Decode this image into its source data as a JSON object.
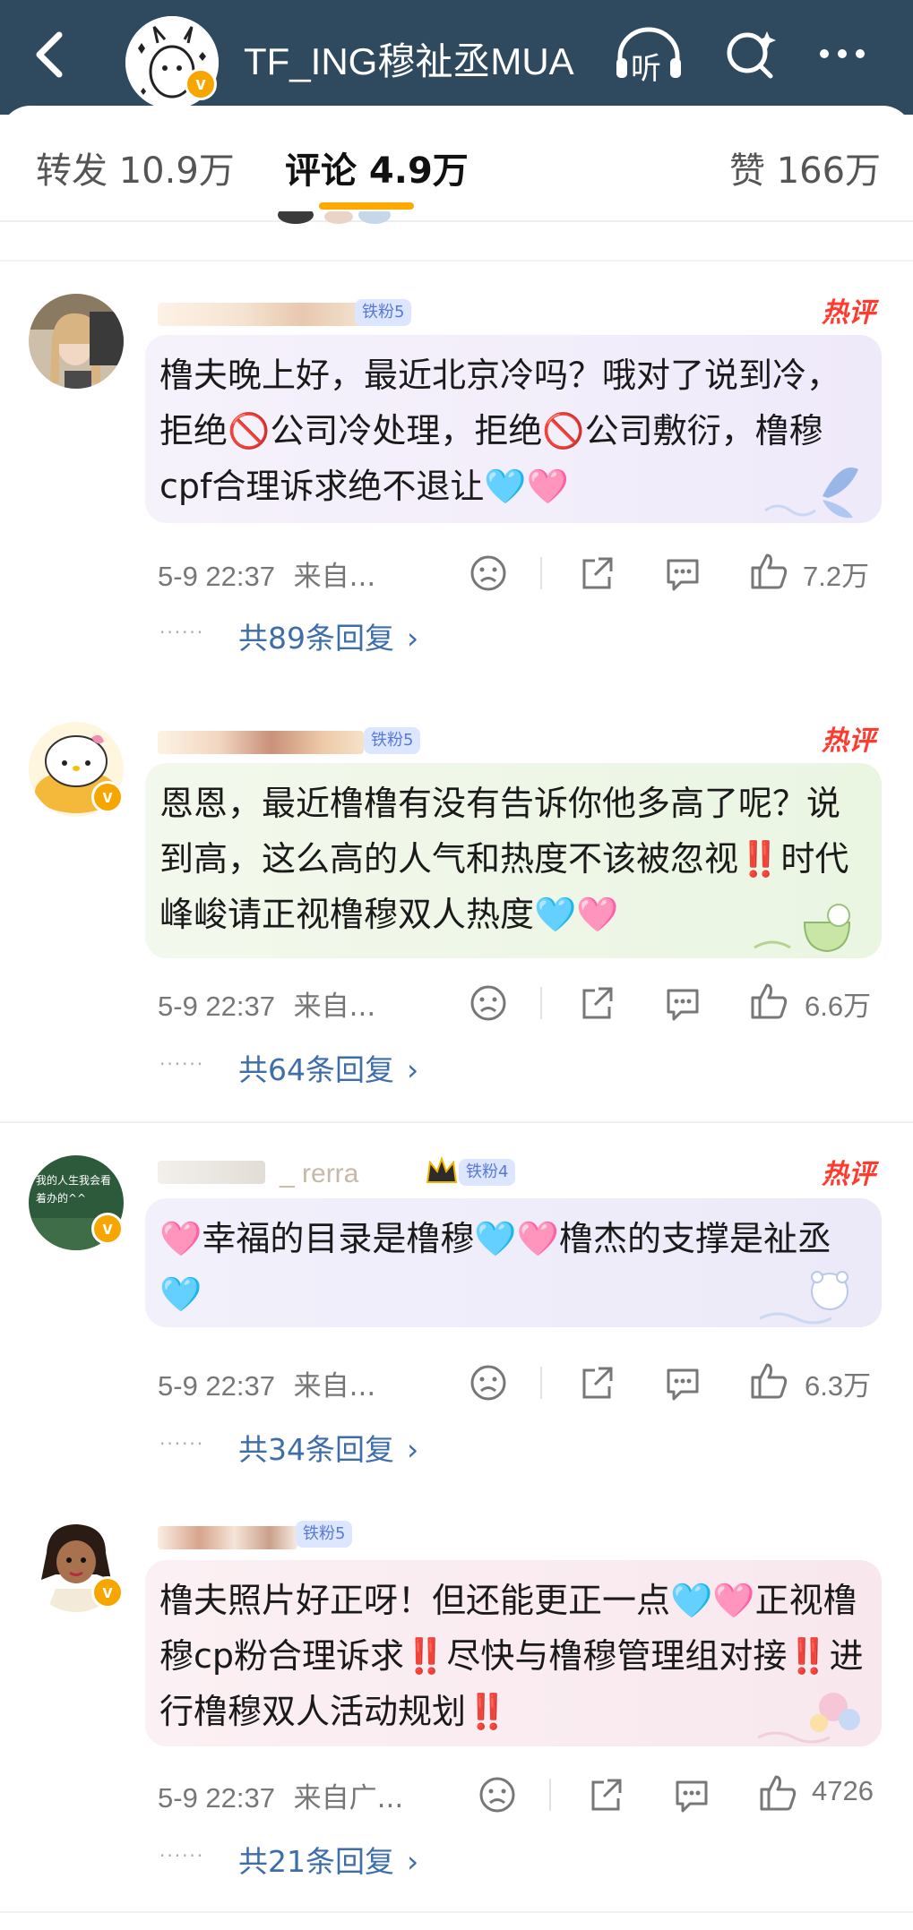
{
  "header": {
    "title": "TF_ING穆祉丞MUA",
    "listen_label": "听"
  },
  "tabs": {
    "repost": "转发 10.9万",
    "comments": "评论 4.9万",
    "likes": "赞 166万"
  },
  "comments": [
    {
      "fan_level": "铁粉5",
      "hot_label": "热评",
      "text": "橹夫晚上好，最近北京冷吗？哦对了说到冷，拒绝🚫公司冷处理，拒绝🚫公司敷衍，橹穆 cpf合理诉求绝不退让🩵🩷",
      "time": "5-9 22:37",
      "source": "来自...",
      "likes": "7.2万",
      "replies": "共89条回复"
    },
    {
      "fan_level": "铁粉5",
      "hot_label": "热评",
      "text": "恩恩，最近橹橹有没有告诉你他多高了呢？说到高，这么高的人气和热度不该被忽视‼️时代峰峻请正视橹穆双人热度🩵🩷",
      "time": "5-9 22:37",
      "source": "来自...",
      "likes": "6.6万",
      "replies": "共64条回复"
    },
    {
      "name_fragment": "_ rerra",
      "fan_level": "铁粉4",
      "hot_label": "热评",
      "avatar_text": "我的人生我会看着办的^^",
      "text": "🩷幸福的目录是橹穆🩵🩷橹杰的支撑是祉丞🩵",
      "time": "5-9 22:37",
      "source": "来自...",
      "likes": "6.3万",
      "replies": "共34条回复"
    },
    {
      "fan_level": "铁粉5",
      "text": "橹夫照片好正呀！但还能更正一点🩵🩷正视橹穆cp粉合理诉求‼️尽快与橹穆管理组对接‼️进行橹穆双人活动规划‼️",
      "time": "5-9 22:37",
      "source": "来自广...",
      "likes": "4726",
      "replies": "共21条回复"
    }
  ],
  "colors": {
    "header_bg": "#2f4a5f",
    "tab_indicator": "#ffa900",
    "hot_red": "#ff3b2f",
    "reply_link": "#3e6ea9",
    "verified_badge": "#f7a600"
  }
}
